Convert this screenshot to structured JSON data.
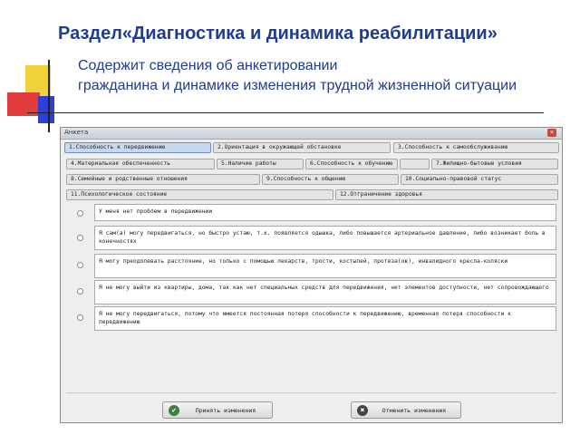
{
  "heading": {
    "title": "Раздел«Диагностика и динамика реабилитации»",
    "description_line1": "Содержит сведения об анкетировании",
    "description_line2": "гражданина и динамике изменения трудной жизненной ситуации"
  },
  "window": {
    "title": "Анкета",
    "close_label": "×"
  },
  "tabs": [
    "1.Способность к передвижению",
    "2.Ориентация в окружающей обстановке",
    "3.Способность к самообслуживанию",
    "4.Материальная обеспеченность",
    "5.Наличие работы",
    "6.Способность к обучению",
    "7.Жилищно-бытовые условия",
    "8.Семейные и родственные отношения",
    "9.Способность к общению",
    "10.Социально-правовой статус",
    "11.Психологическое состояние",
    "12.Отграничение здоровья"
  ],
  "answers": [
    "У меня нет проблем в передвижении",
    "Я сам(а) могу передвигаться, но быстро устаю, т.к. появляется одышка, либо повышается артериальное давление, либо возникает боль в конечностях",
    "Я могу преодолевать расстояние, но только с помощью лекарств, трости, костылей, протеза(ов), инвалидного кресла-коляски",
    "Я не могу выйти из квартиры, дома, так как нет специальных средств для передвижения, нет элементов доступности, нет сопровождающего",
    "Я не могу передвигаться, потому что имеется постоянная потеря способности к передвижению, временная потеря способности к передвижению"
  ],
  "buttons": {
    "accept_label": "Принять изменения",
    "cancel_label": "Отменить изменения"
  },
  "colors": {
    "title": "#1f3d8f",
    "active_tab": "#c6d9ee"
  }
}
